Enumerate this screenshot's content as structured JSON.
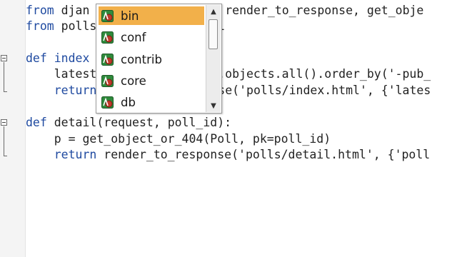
{
  "code": {
    "line1": {
      "kw": "from",
      "a": " djan",
      "b": "rt render_to_response, get_obje"
    },
    "line2": {
      "kw": "from",
      "a": " polls",
      "b": "oll"
    },
    "line4": {
      "kw": "def",
      "a": " index",
      "b": ""
    },
    "line5": {
      "a": "    latest",
      "b": "ll.objects.all().order_by('-pub_"
    },
    "line6": {
      "kw": "    return",
      "b": "nse('polls/index.html', {'lates"
    },
    "line8": {
      "kw": "def",
      "a": " detail(request, poll_id):"
    },
    "line9": {
      "a": "    p = get_object_or_404(Poll, pk=poll_id)"
    },
    "line10": {
      "kw": "    return",
      "a": " render_to_response('polls/detail.html', {'poll"
    }
  },
  "autocomplete": {
    "items": [
      {
        "label": "bin",
        "icon": "module-icon",
        "selected": true
      },
      {
        "label": "conf",
        "icon": "module-icon",
        "selected": false
      },
      {
        "label": "contrib",
        "icon": "module-icon",
        "selected": false
      },
      {
        "label": "core",
        "icon": "module-icon",
        "selected": false
      },
      {
        "label": "db",
        "icon": "module-icon",
        "selected": false
      }
    ],
    "scroll_up_glyph": "▲",
    "scroll_down_glyph": "▼"
  },
  "colors": {
    "keyword": "#1f4aa0",
    "selection": "#f2b04a",
    "icon_green": "#2f8a3c",
    "icon_red": "#c0392b"
  }
}
